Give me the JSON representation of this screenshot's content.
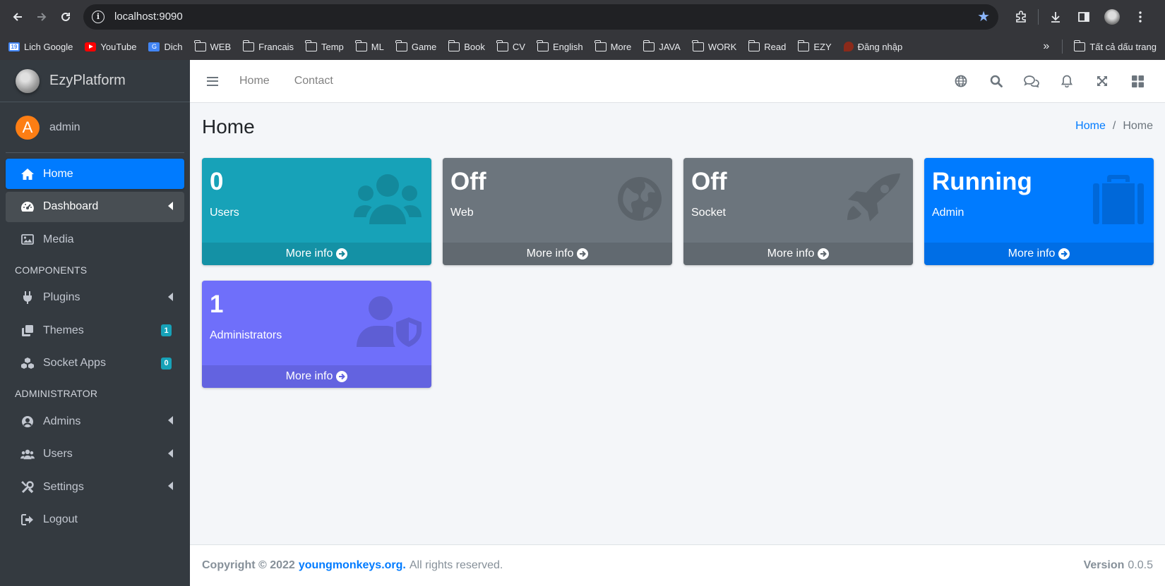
{
  "browser": {
    "url": "localhost:9090",
    "bookmarks": [
      {
        "label": "Lich Google",
        "icon": "google-calendar-icon"
      },
      {
        "label": "YouTube",
        "icon": "youtube-icon"
      },
      {
        "label": "Dich",
        "icon": "google-translate-icon"
      },
      {
        "label": "WEB",
        "icon": "folder-icon"
      },
      {
        "label": "Francais",
        "icon": "folder-icon"
      },
      {
        "label": "Temp",
        "icon": "folder-icon"
      },
      {
        "label": "ML",
        "icon": "folder-icon"
      },
      {
        "label": "Game",
        "icon": "folder-icon"
      },
      {
        "label": "Book",
        "icon": "folder-icon"
      },
      {
        "label": "CV",
        "icon": "folder-icon"
      },
      {
        "label": "English",
        "icon": "folder-icon"
      },
      {
        "label": "More",
        "icon": "folder-icon"
      },
      {
        "label": "JAVA",
        "icon": "folder-icon"
      },
      {
        "label": "WORK",
        "icon": "folder-icon"
      },
      {
        "label": "Read",
        "icon": "folder-icon"
      },
      {
        "label": "EZY",
        "icon": "folder-icon"
      },
      {
        "label": "Đăng nhập",
        "icon": "login-icon"
      }
    ],
    "all_bookmarks": "Tất cả dấu trang",
    "calendar_day": "19",
    "translate_glyph": "G"
  },
  "sidebar": {
    "brand": "EzyPlatform",
    "user": {
      "initial": "A",
      "name": "admin"
    },
    "items": [
      {
        "label": "Home"
      },
      {
        "label": "Dashboard"
      },
      {
        "label": "Media"
      }
    ],
    "components_header": "COMPONENTS",
    "components": [
      {
        "label": "Plugins"
      },
      {
        "label": "Themes",
        "badge": "1"
      },
      {
        "label": "Socket Apps",
        "badge": "0"
      }
    ],
    "admin_header": "ADMINISTRATOR",
    "admin_items": [
      {
        "label": "Admins"
      },
      {
        "label": "Users"
      },
      {
        "label": "Settings"
      },
      {
        "label": "Logout"
      }
    ]
  },
  "topnav": {
    "links": [
      "Home",
      "Contact"
    ]
  },
  "content": {
    "title": "Home",
    "breadcrumb": {
      "link": "Home",
      "separator": "/",
      "current": "Home"
    }
  },
  "boxes": [
    {
      "value": "0",
      "label": "Users",
      "more": "More info",
      "icon": "users-icon",
      "color": "#17a2b8"
    },
    {
      "value": "Off",
      "label": "Web",
      "more": "More info",
      "icon": "globe-icon",
      "color": "#6c757d"
    },
    {
      "value": "Off",
      "label": "Socket",
      "more": "More info",
      "icon": "rocket-icon",
      "color": "#6c757d"
    },
    {
      "value": "Running",
      "label": "Admin",
      "more": "More info",
      "icon": "suitcase-icon",
      "color": "#007bff"
    },
    {
      "value": "1",
      "label": "Administrators",
      "more": "More info",
      "icon": "user-shield-icon",
      "color": "#6f6ffa"
    }
  ],
  "footer": {
    "copyright": "Copyright © 2022",
    "brand": "youngmonkeys.org.",
    "rights": "All rights reserved.",
    "version_label": "Version",
    "version": "0.0.5"
  }
}
